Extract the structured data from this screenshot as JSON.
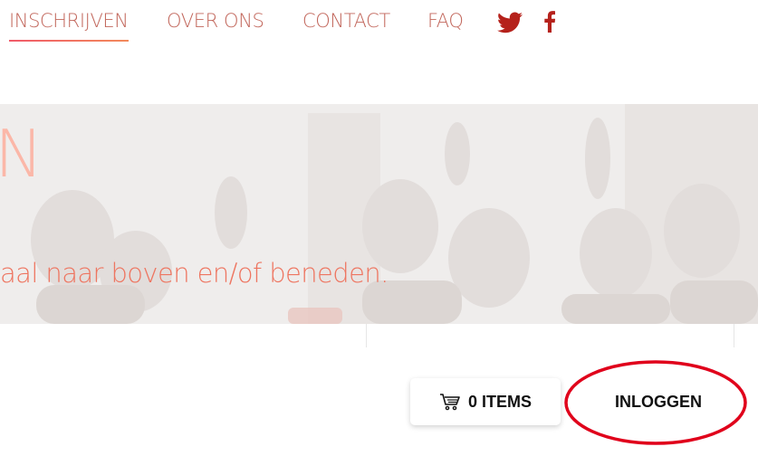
{
  "colors": {
    "nav_text": "#c2675c",
    "nav_underline": "#f05a69",
    "social_icon": "#b5211b",
    "hero_title": "#fbb7a8",
    "hero_subtitle": "#ee7560",
    "annotation": "#e0001b"
  },
  "nav": {
    "items": [
      {
        "label": "INSCHRIJVEN",
        "active": true
      },
      {
        "label": "OVER ONS"
      },
      {
        "label": "CONTACT"
      },
      {
        "label": "FAQ"
      }
    ],
    "social": [
      {
        "icon": "twitter-icon"
      },
      {
        "icon": "facebook-icon"
      }
    ]
  },
  "hero": {
    "title": "N",
    "subtitle": "aal naar boven en/of beneden."
  },
  "cart": {
    "icon": "cart-icon",
    "label": "0 ITEMS"
  },
  "login": {
    "label": "INLOGGEN"
  }
}
